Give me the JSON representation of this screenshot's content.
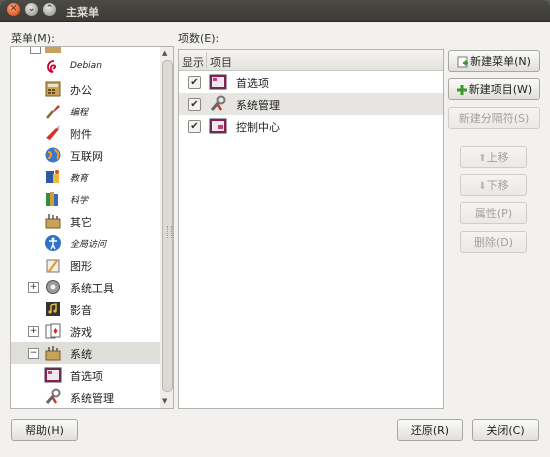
{
  "window": {
    "title": "主菜单"
  },
  "labels": {
    "menus": "菜单(M):",
    "items": "项数(E):"
  },
  "tree": [
    {
      "label": "Debian",
      "italic": true,
      "icon": "debian-swirl-icon"
    },
    {
      "label": "办公",
      "italic": false,
      "icon": "office-calculator-icon"
    },
    {
      "label": "编程",
      "italic": true,
      "icon": "programming-brush-icon"
    },
    {
      "label": "附件",
      "italic": false,
      "icon": "accessories-knife-icon"
    },
    {
      "label": "互联网",
      "italic": false,
      "icon": "internet-globe-icon"
    },
    {
      "label": "教育",
      "italic": true,
      "icon": "education-icon"
    },
    {
      "label": "科学",
      "italic": true,
      "icon": "science-books-icon"
    },
    {
      "label": "其它",
      "italic": false,
      "icon": "other-box-icon"
    },
    {
      "label": "全局访问",
      "italic": true,
      "icon": "accessibility-icon"
    },
    {
      "label": "图形",
      "italic": false,
      "icon": "graphics-icon"
    },
    {
      "label": "系统工具",
      "italic": false,
      "icon": "system-gear-icon",
      "expander": "+"
    },
    {
      "label": "影音",
      "italic": false,
      "icon": "multimedia-icon"
    },
    {
      "label": "游戏",
      "italic": false,
      "icon": "games-cards-icon",
      "expander": "+"
    },
    {
      "label": "系统",
      "italic": false,
      "icon": "system-box-icon",
      "expander": "−",
      "selected": true
    },
    {
      "label": "首选项",
      "italic": false,
      "icon": "preferences-icon"
    },
    {
      "label": "系统管理",
      "italic": false,
      "icon": "administration-icon"
    }
  ],
  "table": {
    "col_show": "显示",
    "col_item": "项目",
    "rows": [
      {
        "label": "首选项",
        "checked": true,
        "icon": "preferences-icon"
      },
      {
        "label": "系统管理",
        "checked": true,
        "icon": "administration-icon",
        "selected": true
      },
      {
        "label": "控制中心",
        "checked": true,
        "icon": "control-center-icon"
      }
    ]
  },
  "buttons": {
    "new_menu": "新建菜单(N)",
    "new_item": "新建项目(W)",
    "new_separator": "新建分隔符(S)",
    "move_up": "上移",
    "move_down": "下移",
    "properties": "属性(P)",
    "delete": "删除(D)",
    "help": "帮助(H)",
    "revert": "还原(R)",
    "close": "关闭(C)"
  }
}
